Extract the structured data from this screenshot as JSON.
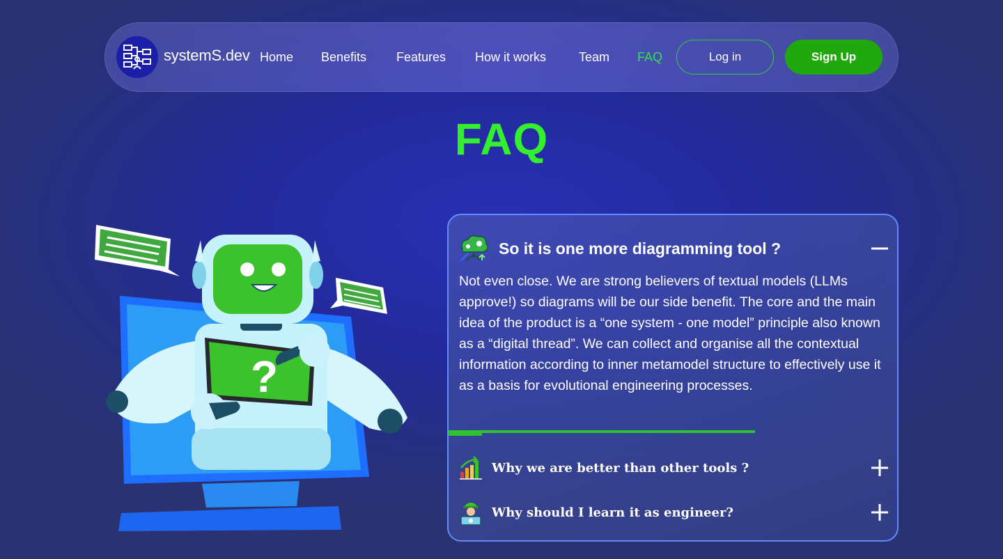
{
  "brand": {
    "name": "systemS.dev",
    "logo_icon": "diagram-blocks-icon"
  },
  "nav": {
    "links": [
      {
        "label": "Home",
        "active": false
      },
      {
        "label": "Benefits",
        "active": false
      },
      {
        "label": "Features",
        "active": false
      },
      {
        "label": "How it works",
        "active": false
      },
      {
        "label": "Team",
        "active": false
      },
      {
        "label": "FAQ",
        "active": true
      }
    ],
    "login_label": "Log in",
    "signup_label": "Sign Up"
  },
  "page": {
    "title": "FAQ"
  },
  "faq": {
    "items": [
      {
        "question": "So it is one more diagramming tool ?",
        "icon": "tree-network-icon",
        "expanded": true,
        "toggle_symbol": "−",
        "answer": "Not even close. We are strong believers of textual models (LLMs approve!) so diagrams will be our side benefit. The core and the main idea of the product is a “one system - one model” principle also known as a “digital thread”. We can collect and organise all the contextual information according to inner metamodel structure to effectively use it as a basis for evolutional engineering processes."
      },
      {
        "question": "Why we are better than other tools ?",
        "icon": "growth-chart-icon",
        "expanded": false,
        "toggle_symbol": "+"
      },
      {
        "question": "Why should I learn it as engineer?",
        "icon": "engineer-laptop-icon",
        "expanded": false,
        "toggle_symbol": "+"
      }
    ],
    "autoplay_progress": 0.11
  },
  "colors": {
    "accent_green": "#33ef2f",
    "button_green": "#21a80f",
    "card_border": "#5f8dff"
  }
}
